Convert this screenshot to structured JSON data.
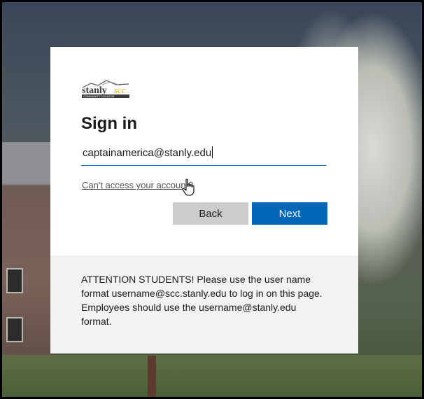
{
  "logo": {
    "brand": "stanly",
    "subtitle": "COMMUNITY COLLEGE"
  },
  "signin": {
    "title": "Sign in",
    "email_value": "captainamerica@stanly.edu",
    "cant_access_link": "Can't access your account?",
    "back_label": "Back",
    "next_label": "Next"
  },
  "notice": {
    "text": "ATTENTION STUDENTS! Please use the user name format username@scc.stanly.edu to log in on this page. Employees should use the username@stanly.edu format."
  },
  "colors": {
    "accent": "#0067b8",
    "back_button": "#cccccc",
    "notice_bg": "#f2f2f2"
  },
  "icons": {
    "cursor": "hand-pointer-icon"
  }
}
